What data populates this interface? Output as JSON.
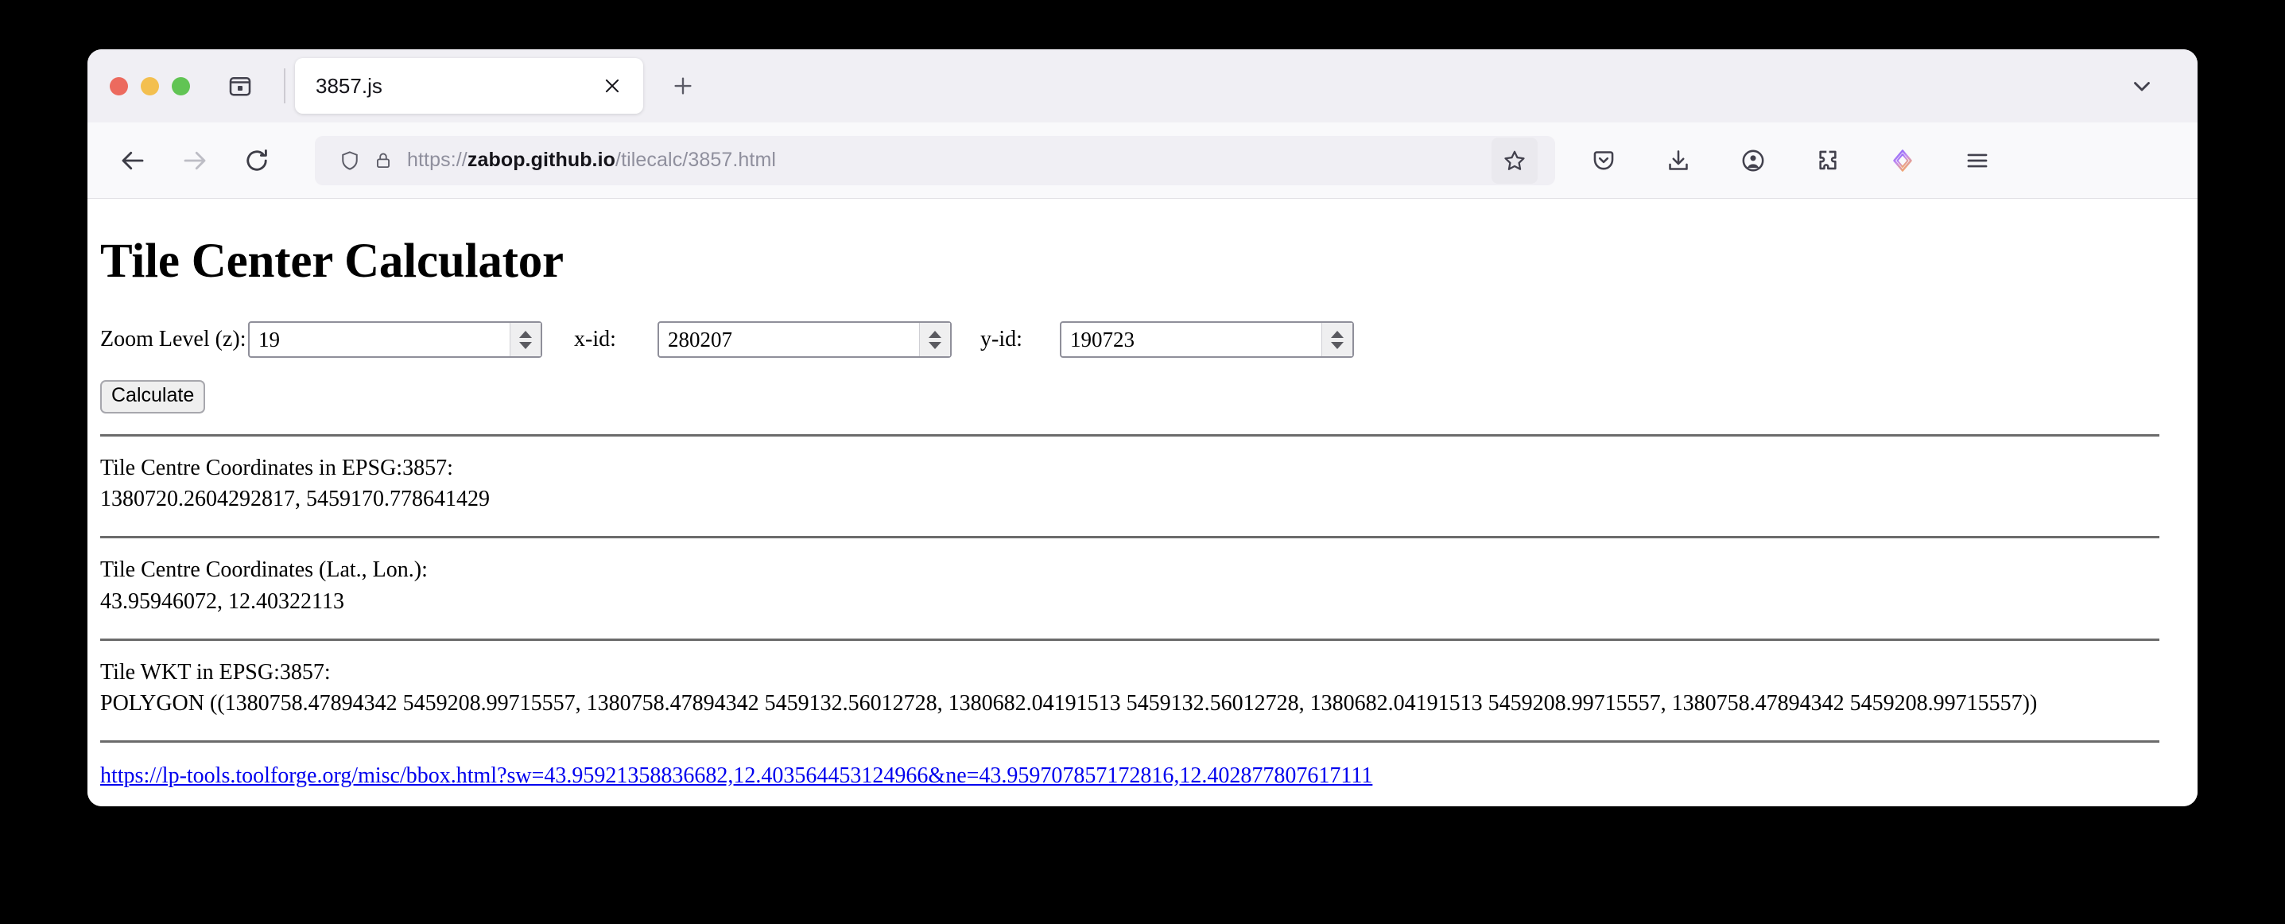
{
  "browser": {
    "tab": {
      "title": "3857.js",
      "close_icon": "close-icon"
    },
    "new_tab_label": "+",
    "url": {
      "scheme": "https://",
      "host": "zabop.github.io",
      "path": "/tilecalc/3857.html",
      "full": "https://zabop.github.io/tilecalc/3857.html"
    },
    "nav": {
      "back": "back-arrow-icon",
      "forward": "forward-arrow-icon",
      "reload": "reload-icon"
    },
    "toolbar_icons": [
      "pocket-save-icon",
      "downloads-icon",
      "account-icon",
      "extensions-icon",
      "firefox-labs-icon",
      "app-menu-icon"
    ],
    "bookmark_icon": "star-icon",
    "tab_list_icon": "tab-list-icon",
    "tabstrip_chevron_icon": "chevron-down-icon"
  },
  "page": {
    "title": "Tile Center Calculator",
    "form": {
      "zoom_label": "Zoom Level (z):",
      "zoom_value": "19",
      "x_label": "x-id:",
      "x_value": "280207",
      "y_label": "y-id:",
      "y_value": "190723",
      "calculate_label": "Calculate"
    },
    "results": [
      {
        "label": "Tile Centre Coordinates in EPSG:3857:",
        "value": "1380720.2604292817, 5459170.778641429"
      },
      {
        "label": "Tile Centre Coordinates (Lat., Lon.):",
        "value": "43.95946072, 12.40322113"
      },
      {
        "label": "Tile WKT in EPSG:3857:",
        "value": "POLYGON ((1380758.47894342 5459208.99715557, 1380758.47894342 5459132.56012728, 1380682.04191513 5459132.56012728, 1380682.04191513 5459208.99715557, 1380758.47894342 5459208.99715557))"
      }
    ],
    "bbox_link": {
      "text": "https://lp-tools.toolforge.org/misc/bbox.html?sw=43.95921358836682,12.403564453124966&ne=43.959707857172816,12.402877807617111",
      "color": "#0000ee"
    }
  }
}
